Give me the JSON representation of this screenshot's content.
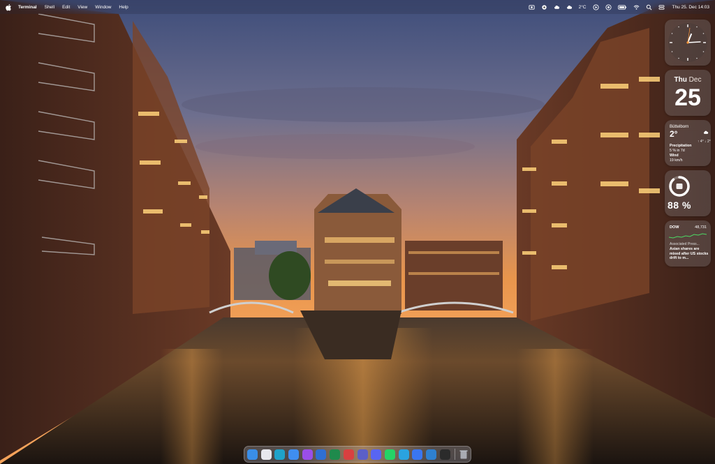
{
  "menubar": {
    "app_name": "Terminal",
    "items": [
      "Shell",
      "Edit",
      "View",
      "Window",
      "Help"
    ],
    "temperature": "2°C",
    "clock": "Thu 25. Dec 14:03"
  },
  "widgets": {
    "date": {
      "day_of_week": "Thu",
      "month": "Dec",
      "day": "25"
    },
    "weather": {
      "location": "Büttelborn",
      "temperature": "2°",
      "hi_lo": "↑ 4° ↓ 2°",
      "precipitation_label": "Precipitation",
      "precipitation_value": "5 % in 7d",
      "wind_label": "Wind",
      "wind_value": "19 km/h"
    },
    "battery": {
      "percent_text": "88 %",
      "level": 0.88
    },
    "stocks": {
      "symbol": "DOW",
      "price": "48,731",
      "source": "Associated Press...",
      "headline": "Asian shares are mixed after US stocks drift to m..."
    }
  },
  "dock": {
    "apps": [
      {
        "name": "finder",
        "color": "#3a8ee8",
        "glyph": ""
      },
      {
        "name": "launchpad",
        "color": "#e8e8ee",
        "glyph": ""
      },
      {
        "name": "edge",
        "color": "#1fa2c9",
        "glyph": ""
      },
      {
        "name": "mail",
        "color": "#3f8ef0",
        "glyph": ""
      },
      {
        "name": "app-purple",
        "color": "#9a4ee8",
        "glyph": ""
      },
      {
        "name": "outlook",
        "color": "#2f6fd2",
        "glyph": ""
      },
      {
        "name": "excel",
        "color": "#1f8a4c",
        "glyph": ""
      },
      {
        "name": "app-red",
        "color": "#d94040",
        "glyph": ""
      },
      {
        "name": "teams",
        "color": "#5b5fc7",
        "glyph": ""
      },
      {
        "name": "discord",
        "color": "#5865f2",
        "glyph": ""
      },
      {
        "name": "whatsapp",
        "color": "#25d366",
        "glyph": ""
      },
      {
        "name": "telegram",
        "color": "#2aa3e0",
        "glyph": ""
      },
      {
        "name": "signal",
        "color": "#3a76f0",
        "glyph": ""
      },
      {
        "name": "vscode",
        "color": "#2f80d0",
        "glyph": ""
      },
      {
        "name": "terminal",
        "color": "#2b2b2b",
        "glyph": ""
      }
    ],
    "trash": {
      "name": "trash",
      "color": "#b8bcc4"
    }
  }
}
